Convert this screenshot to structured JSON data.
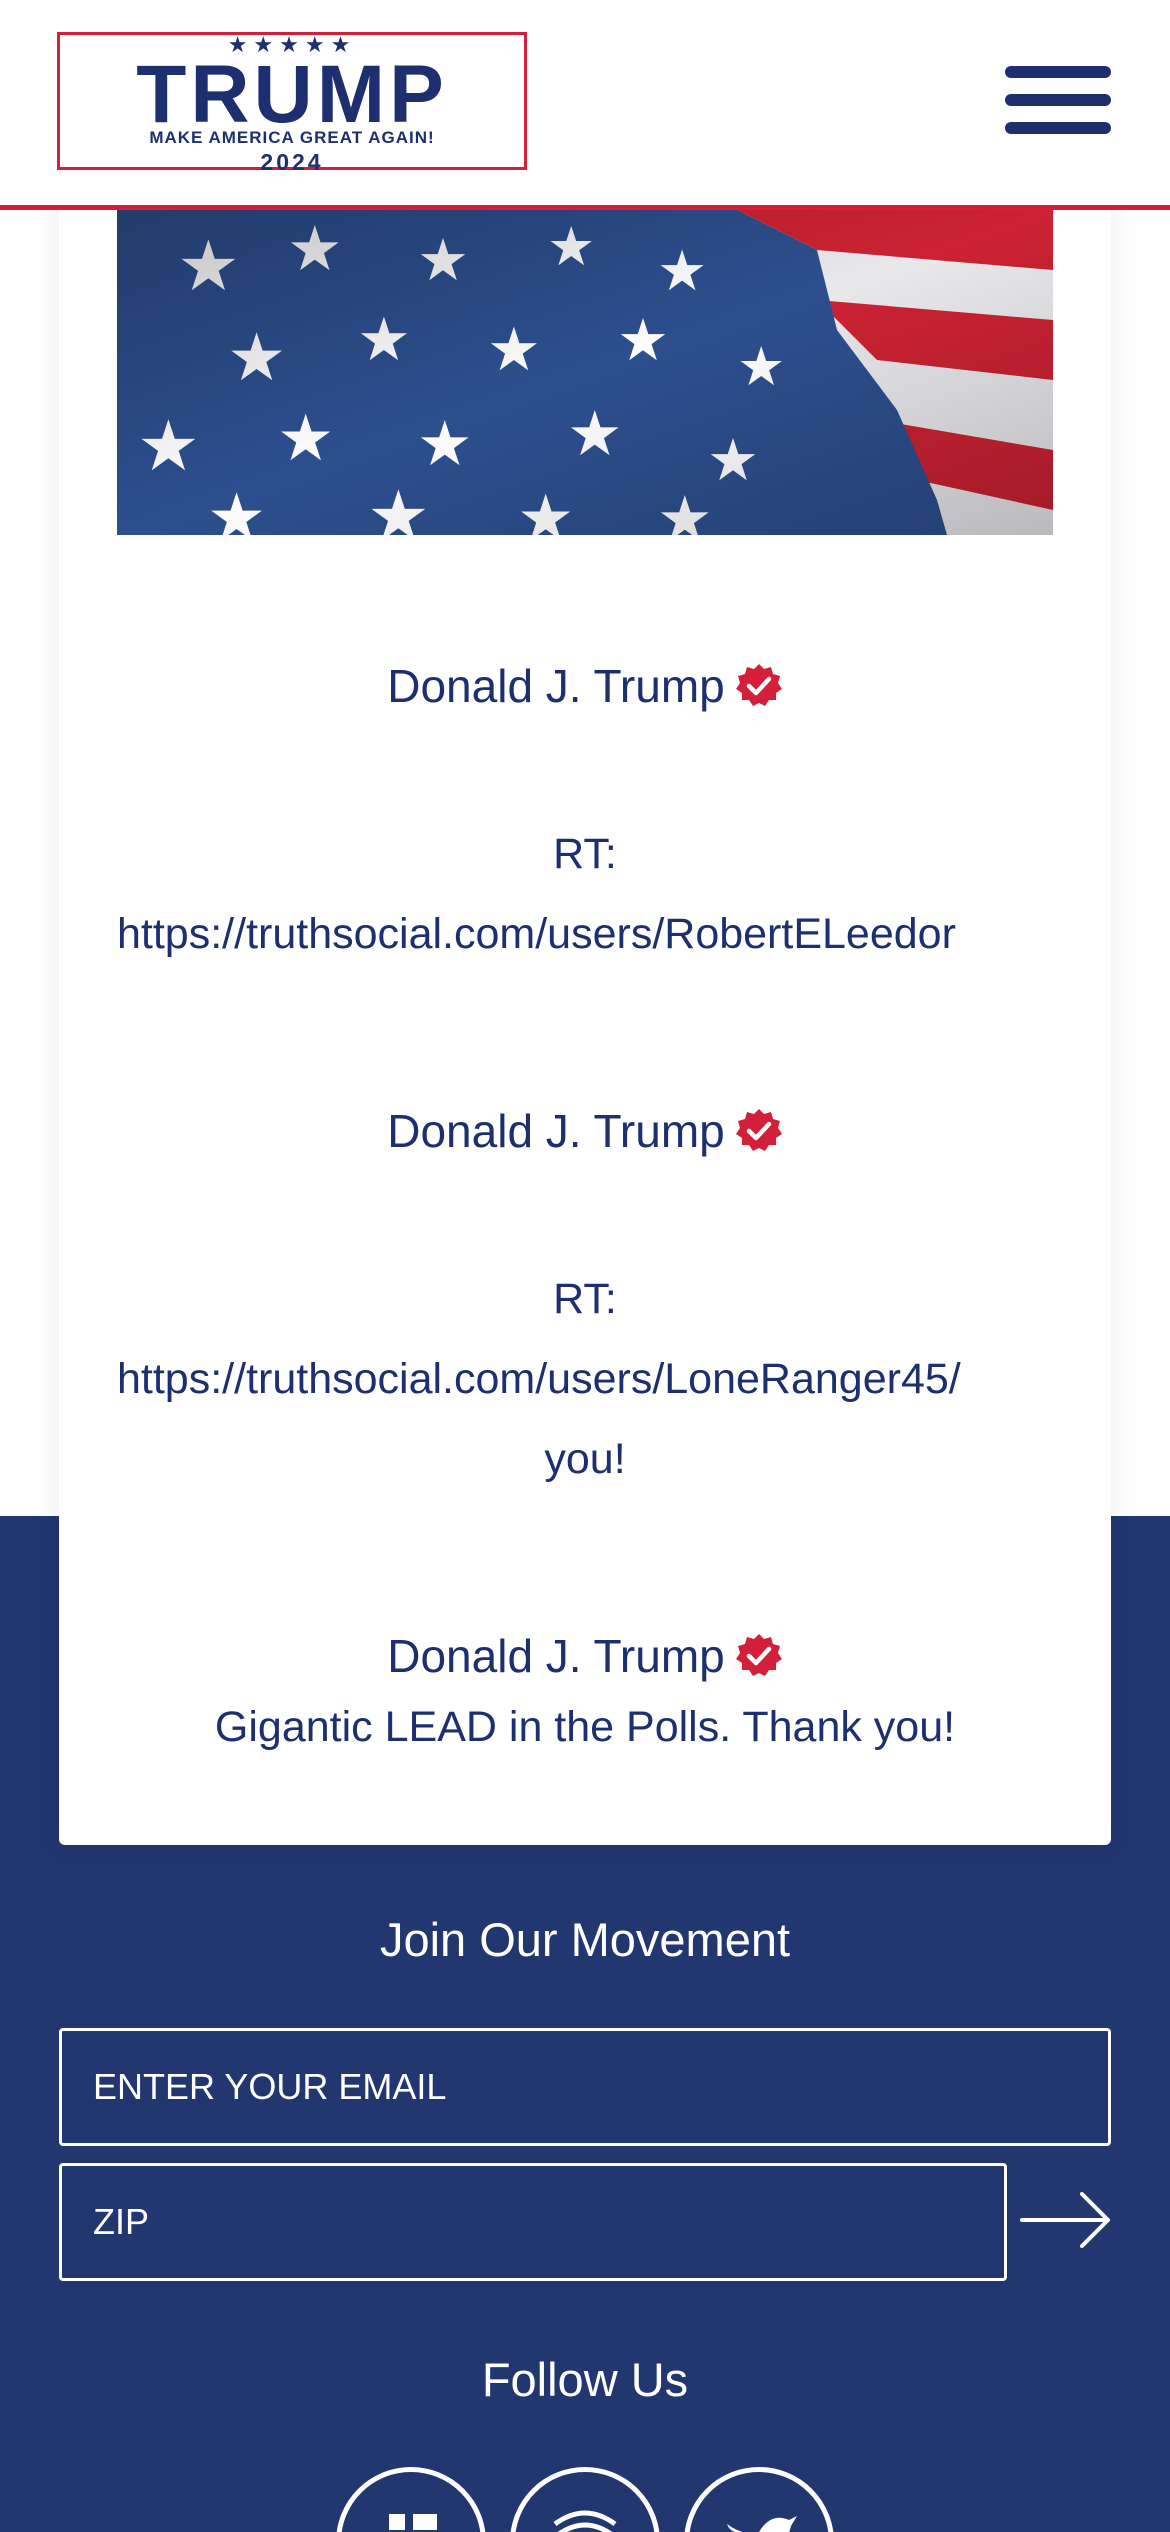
{
  "header": {
    "logo": {
      "stars": "★★★★★",
      "wordmark": "TRUMP",
      "tagline": "MAKE AMERICA GREAT AGAIN!",
      "year": "2024"
    },
    "menu_icon": "hamburger-menu-icon"
  },
  "feed": {
    "image": "american-flag",
    "posts": [
      {
        "author": "Donald J. Trump",
        "verified_icon": "verified-badge-icon",
        "rt_label": "RT:",
        "url": "https://truthsocial.com/users/RobertELeedor"
      },
      {
        "author": "Donald J. Trump",
        "verified_icon": "verified-badge-icon",
        "rt_label": "RT:",
        "url": "https://truthsocial.com/users/LoneRanger45/",
        "trailing": "you!"
      },
      {
        "author": "Donald J. Trump",
        "verified_icon": "verified-badge-icon",
        "text": "Gigantic LEAD in the Polls. Thank you!"
      }
    ]
  },
  "join": {
    "title": "Join Our Movement",
    "email_placeholder": "ENTER YOUR EMAIL",
    "zip_placeholder": "ZIP",
    "submit_icon": "arrow-right-icon"
  },
  "follow": {
    "title": "Follow Us",
    "networks": [
      "facebook-icon",
      "truth-social-icon",
      "twitter-icon"
    ]
  },
  "colors": {
    "navy": "#1d2f6f",
    "navy_band": "#223670",
    "red": "#d41f3a",
    "white": "#ffffff"
  }
}
